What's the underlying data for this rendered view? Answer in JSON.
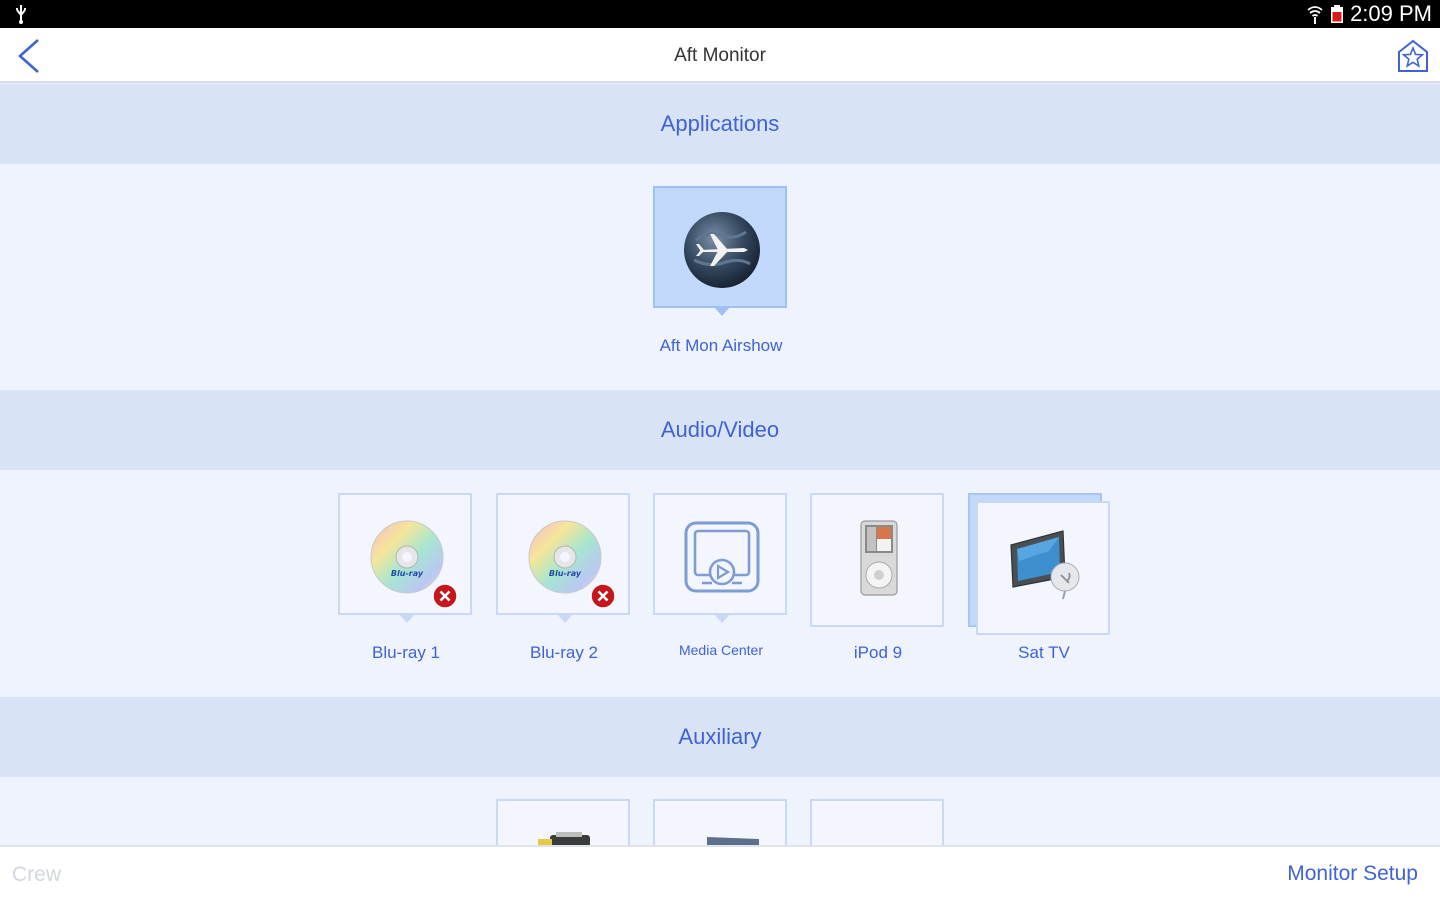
{
  "status_bar": {
    "time": "2:09 PM",
    "icons": [
      "usb-icon",
      "wifi-icon",
      "battery-icon"
    ]
  },
  "header": {
    "title": "Aft Monitor",
    "back_icon": "chevron-left-icon",
    "favorite_icon": "favorite-home-icon"
  },
  "sections": [
    {
      "title": "Applications",
      "items": [
        {
          "label": "Aft Mon Airshow",
          "icon": "airshow-globe-icon",
          "selected": true
        }
      ]
    },
    {
      "title": "Audio/Video",
      "items": [
        {
          "label": "Blu-ray 1",
          "icon": "bluray-disc-icon",
          "error": true
        },
        {
          "label": "Blu-ray 2",
          "icon": "bluray-disc-icon",
          "error": true
        },
        {
          "label": "Media Center",
          "icon": "media-center-icon"
        },
        {
          "label": "iPod 9",
          "icon": "ipod-icon"
        },
        {
          "label": "Sat TV",
          "icon": "sat-tv-icon",
          "stacked": true
        }
      ]
    },
    {
      "title": "Auxiliary",
      "items": [
        {
          "icon": "aux-device-icon"
        },
        {
          "icon": "aux-laptop-icon"
        },
        {
          "icon": "aux-blank-icon"
        }
      ]
    }
  ],
  "footer": {
    "crew_label": "Crew",
    "setup_label": "Monitor Setup"
  },
  "colors": {
    "accent": "#3f63d6",
    "section_header_bg": "#d9e3f6",
    "body_bg": "#eef3fd",
    "selected_tile": "#c3d9fb"
  }
}
